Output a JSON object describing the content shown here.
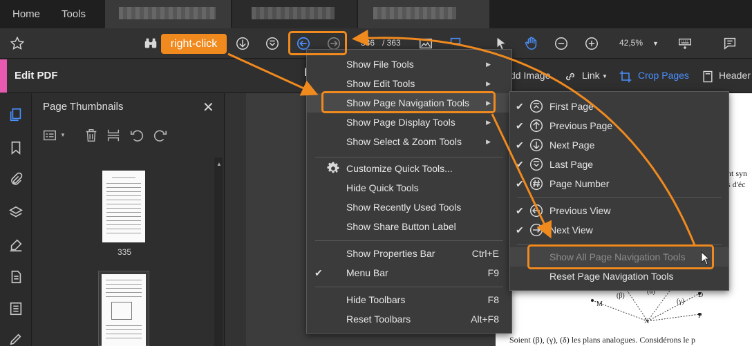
{
  "tabs": {
    "home": "Home",
    "tools": "Tools"
  },
  "toolbar": {
    "page_current": "336",
    "page_total": "/ 363",
    "zoom": "42,5%"
  },
  "callout": {
    "label": "right-click"
  },
  "edit_bar": {
    "title": "Edit PDF",
    "add_image": "dd Image",
    "link": "Link",
    "crop_pages": "Crop Pages",
    "header": "Header"
  },
  "thumbnails": {
    "title": "Page Thumbnails",
    "page_label": "335"
  },
  "context_menu": {
    "items": [
      {
        "label": "Show File Tools",
        "submenu": true
      },
      {
        "label": "Show Edit Tools",
        "submenu": true
      },
      {
        "label": "Show Page Navigation Tools",
        "submenu": true
      },
      {
        "label": "Show Page Display Tools",
        "submenu": true
      },
      {
        "label": "Show Select & Zoom Tools",
        "submenu": true
      },
      {
        "label": "Customize Quick Tools..."
      },
      {
        "label": "Hide Quick Tools"
      },
      {
        "label": "Show Recently Used Tools"
      },
      {
        "label": "Show Share Button Label"
      },
      {
        "label": "Show Properties Bar",
        "shortcut": "Ctrl+E"
      },
      {
        "label": "Menu Bar",
        "shortcut": "F9",
        "checked": true
      },
      {
        "label": "Hide Toolbars",
        "shortcut": "F8"
      },
      {
        "label": "Reset Toolbars",
        "shortcut": "Alt+F8"
      }
    ]
  },
  "nav_submenu": {
    "items": [
      {
        "label": "First Page",
        "icon": "first-page-icon",
        "checked": true
      },
      {
        "label": "Previous Page",
        "icon": "previous-page-icon",
        "checked": true
      },
      {
        "label": "Next Page",
        "icon": "next-page-icon",
        "checked": true
      },
      {
        "label": "Last Page",
        "icon": "last-page-icon",
        "checked": true
      },
      {
        "label": "Page Number",
        "icon": "page-number-icon",
        "checked": true
      },
      {
        "label": "Previous View",
        "icon": "previous-view-icon",
        "checked": true
      },
      {
        "label": "Next View",
        "icon": "next-view-icon",
        "checked": true
      },
      {
        "label": "Show All Page Navigation Tools"
      },
      {
        "label": "Reset Page Navigation Tools"
      }
    ]
  },
  "document": {
    "side_text_1": "nt syn",
    "side_text_2": "s d'éc",
    "footer_text": "Soient (β), (γ), (δ) les plans analogues. Considérons le p",
    "fig_labels": [
      "M",
      "(β)",
      "(α)",
      "X",
      "(γ)",
      "D",
      "P"
    ]
  },
  "colors": {
    "accent_orange": "#f08a1e",
    "edit_accent": "#e75ab0",
    "link_blue": "#4a90ff"
  }
}
